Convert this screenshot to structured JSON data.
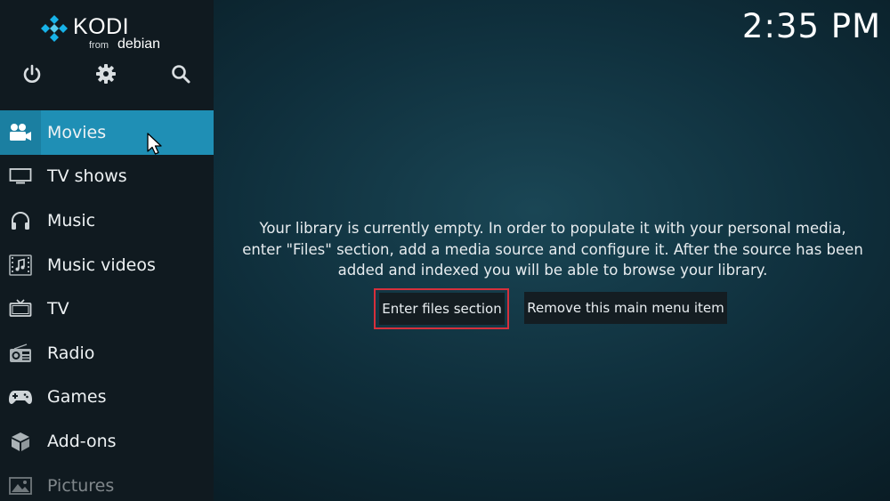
{
  "logo": {
    "name": "KODI",
    "from": "from",
    "distro": "debian",
    "icon": "kodi-diamond-logo"
  },
  "top_icons": [
    {
      "name": "power-icon"
    },
    {
      "name": "gear-icon"
    },
    {
      "name": "search-icon"
    }
  ],
  "sidebar": {
    "items": [
      {
        "label": "Movies",
        "icon": "movie-camera-icon",
        "active": true
      },
      {
        "label": "TV shows",
        "icon": "monitor-icon"
      },
      {
        "label": "Music",
        "icon": "headphones-icon"
      },
      {
        "label": "Music videos",
        "icon": "film-note-icon"
      },
      {
        "label": "TV",
        "icon": "tv-icon"
      },
      {
        "label": "Radio",
        "icon": "radio-icon"
      },
      {
        "label": "Games",
        "icon": "gamepad-icon"
      },
      {
        "label": "Add-ons",
        "icon": "box-icon"
      },
      {
        "label": "Pictures",
        "icon": "picture-icon"
      }
    ]
  },
  "clock": "2:35 PM",
  "main": {
    "message": "Your library is currently empty. In order to populate it with your personal media, enter \"Files\" section, add a media source and configure it. After the source has been added and indexed you will be able to browse your library.",
    "enter_button": "Enter files section",
    "remove_button": "Remove this main menu item"
  },
  "colors": {
    "accent": "#1f8fb5",
    "focus_border": "#d6303c",
    "sidebar_bg": "#101a20"
  }
}
